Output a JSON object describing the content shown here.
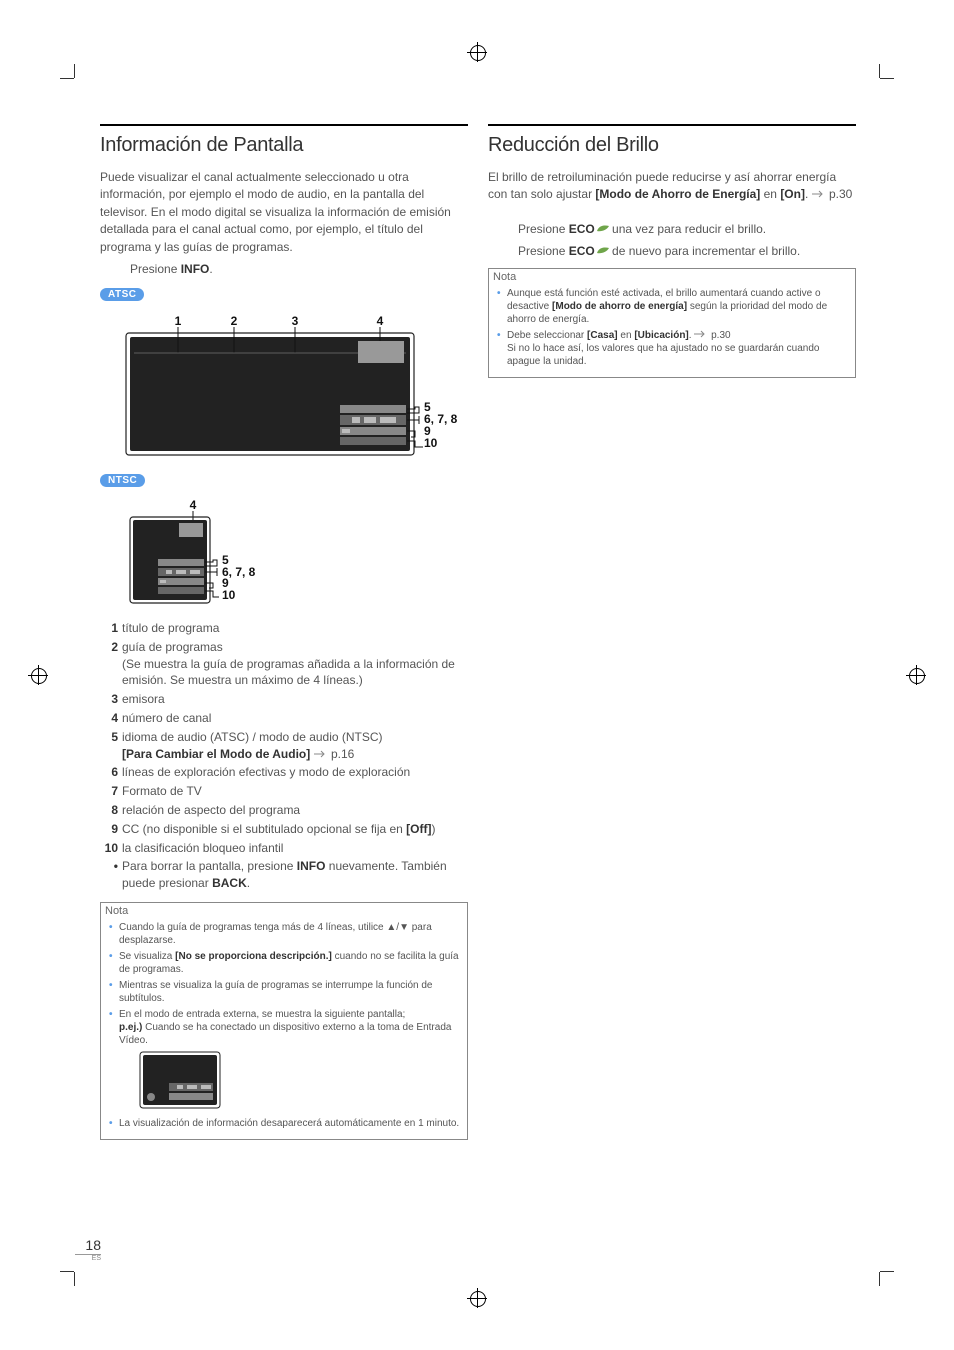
{
  "left": {
    "heading": "Información de Pantalla",
    "intro": "Puede visualizar el canal actualmente seleccionado u otra información, por ejemplo el modo de audio, en la pantalla del televisor. En el modo digital se visualiza la información de emisión detallada para el canal actual como, por ejemplo, el título del programa y las guías de programas.",
    "step_pre": "Presione ",
    "step_btn": "INFO",
    "step_post": ".",
    "badge1": "ATSC",
    "diag1_labels": {
      "l1": "1",
      "l2": "2",
      "l3": "3",
      "l4": "4",
      "r5": "5",
      "r678": "6, 7, 8",
      "r9": "9",
      "r10": "10"
    },
    "badge2": "NTSC",
    "diag2_labels": {
      "t4": "4",
      "r5": "5",
      "r678": "6, 7, 8",
      "r9": "9",
      "r10": "10"
    },
    "items": [
      {
        "n": "1",
        "t": "título de programa"
      },
      {
        "n": "2",
        "t": "guía de programas",
        "sub": "(Se muestra la guía de programas añadida a la información de emisión. Se muestra un máximo de 4 líneas.)"
      },
      {
        "n": "3",
        "t": "emisora"
      },
      {
        "n": "4",
        "t": "número de canal"
      },
      {
        "n": "5",
        "t": "idioma de audio (ATSC) / modo de audio (NTSC)",
        "link_b": "[Para Cambiar el Modo de Audio]",
        "link_p": "p.16"
      },
      {
        "n": "6",
        "t": "líneas de exploración efectivas y modo de exploración"
      },
      {
        "n": "7",
        "t": "Formato de TV"
      },
      {
        "n": "8",
        "t": "relación de aspecto del programa"
      },
      {
        "n": "9",
        "t": "CC (no disponible si el subtitulado opcional se fija en ",
        "t_b": "[Off]",
        "t_post": ")"
      },
      {
        "n": "10",
        "t": "la clasificación bloqueo infantil"
      }
    ],
    "tail_bullet": "Para borrar la pantalla, presione ",
    "tail_b1": "INFO",
    "tail_mid": " nuevamente. También puede presionar ",
    "tail_b2": "BACK",
    "tail_end": ".",
    "nota_hdr": "Nota",
    "nota": [
      {
        "t": "Cuando la guía de programas tenga más de 4 líneas, utilice ▲/▼ para desplazarse."
      },
      {
        "t": "Se visualiza ",
        "b": "[No se proporciona descripción.]",
        "post": " cuando no se facilita la guía de programas."
      },
      {
        "t": "Mientras se visualiza la guía de programas se interrumpe la función de subtítulos."
      },
      {
        "t": "En el modo de entrada externa, se muestra la siguiente pantalla;",
        "sub_b": "p.ej.)",
        "sub": " Cuando se ha conectado un dispositivo externo a la toma de Entrada Vídeo."
      },
      {
        "t": "La visualización de información desaparecerá automáticamente en 1 minuto."
      }
    ]
  },
  "right": {
    "heading": "Reducción del Brillo",
    "intro_pre": "El brillo de retroiluminación puede reducirse y así ahorrar energía con tan solo ajustar ",
    "intro_b1": "[Modo de Ahorro de Energía]",
    "intro_mid": " en ",
    "intro_b2": "[On]",
    "intro_post": ". ",
    "intro_p": "p.30",
    "step1_pre": "Presione ",
    "step1_b": "ECO",
    "step1_post": " una vez para reducir el brillo.",
    "step2_pre": "Presione ",
    "step2_b": "ECO",
    "step2_post": " de nuevo para incrementar el brillo.",
    "nota_hdr": "Nota",
    "nota": [
      {
        "t": "Aunque está función esté activada, el brillo aumentará cuando active o desactive ",
        "b": "[Modo de ahorro de energía]",
        "post": " según la prioridad del modo de ahorro de energía."
      },
      {
        "pre": "Debe seleccionar ",
        "b": "[Casa]",
        "mid": " en ",
        "b2": "[Ubicación]",
        "post": ". ",
        "link": "p.30",
        "sub": "Si no lo hace así, los valores que ha ajustado no se guardarán cuando apague la unidad."
      }
    ]
  },
  "pagenum": "18",
  "pagelang": "ES"
}
